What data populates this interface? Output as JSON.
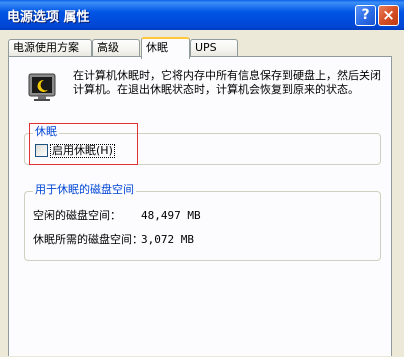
{
  "window": {
    "title": "电源选项 属性",
    "help_button": "?",
    "close_button": "×"
  },
  "tabs": [
    {
      "label": "电源使用方案",
      "active": false
    },
    {
      "label": "高级",
      "active": false
    },
    {
      "label": "休眠",
      "active": true
    },
    {
      "label": "UPS",
      "active": false
    }
  ],
  "hibernate": {
    "icon": "hibernate-monitor-icon",
    "description": "在计算机休眠时，它将内存中所有信息保存到硬盘上，然后关闭计算机。在退出休眠状态时，计算机会恢复到原来的状态。",
    "group_title": "休眠",
    "enable_label": "启用休眠(H)",
    "enable_checked": false
  },
  "disk_space": {
    "group_title": "用于休眠的磁盘空间",
    "free_label": "空闲的磁盘空间：",
    "free_value": "48,497 MB",
    "required_label": "休眠所需的磁盘空间：",
    "required_value": "3,072 MB"
  },
  "colors": {
    "titlebar": "#0055e5",
    "group_title": "#0046d5",
    "highlight_box": "#e03030",
    "active_tab_accent": "#ffc73c"
  }
}
